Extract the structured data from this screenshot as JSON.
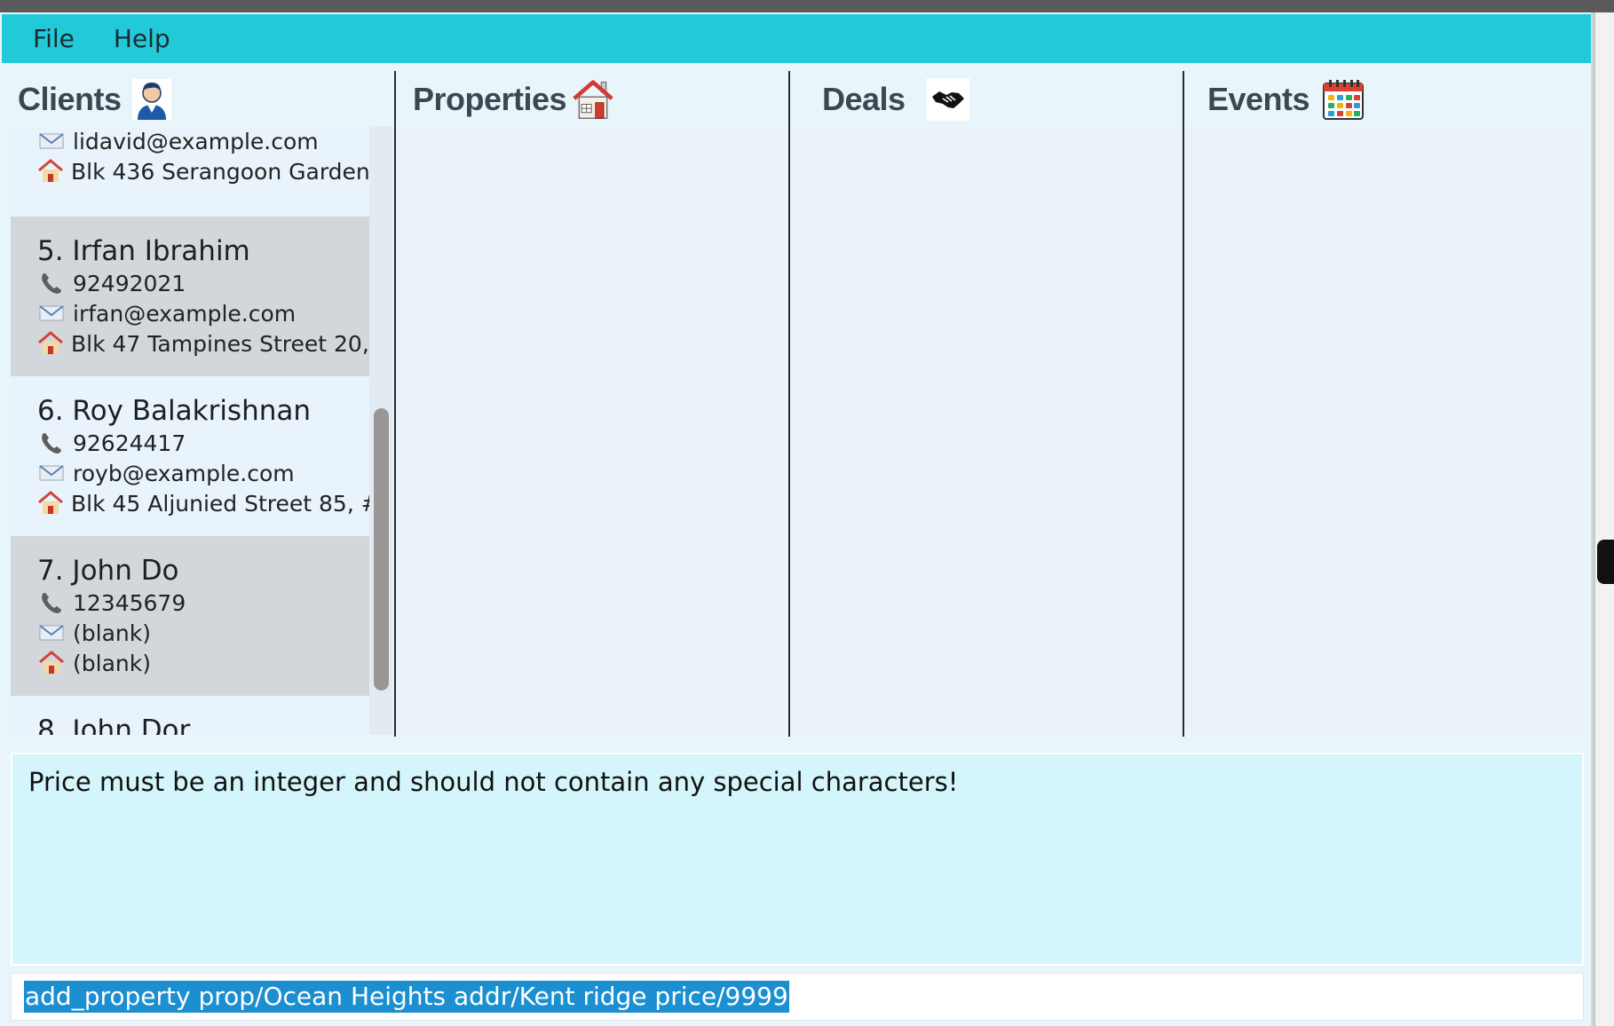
{
  "menu": {
    "file": "File",
    "help": "Help"
  },
  "panels": {
    "clients": {
      "title": "Clients",
      "icon": "person-icon"
    },
    "properties": {
      "title": "Properties",
      "icon": "house-icon"
    },
    "deals": {
      "title": "Deals",
      "icon": "handshake-icon"
    },
    "events": {
      "title": "Events",
      "icon": "calendar-icon"
    }
  },
  "clients_partial_top": {
    "email": "lidavid@example.com",
    "address": "Blk 436 Serangoon Garden..."
  },
  "clients": [
    {
      "name": "5. Irfan Ibrahim",
      "phone": "92492021",
      "email": "irfan@example.com",
      "address": "Blk 47 Tampines Street 20, ..."
    },
    {
      "name": "6. Roy Balakrishnan",
      "phone": "92624417",
      "email": "royb@example.com",
      "address": "Blk 45 Aljunied Street 85, #..."
    },
    {
      "name": "7. John Do",
      "phone": "12345679",
      "email": "(blank)",
      "address": "(blank)"
    },
    {
      "name": "8. John Dor"
    }
  ],
  "result": {
    "message": "Price must be an integer and should not contain any special characters!"
  },
  "command": {
    "value": "add_property prop/Ocean Heights addr/Kent ridge price/9999"
  },
  "colors": {
    "menubar": "#22c9d9",
    "selection": "#1c8fd1",
    "result_bg": "#d4f5fb",
    "alt_card": "#d3d7dc"
  }
}
